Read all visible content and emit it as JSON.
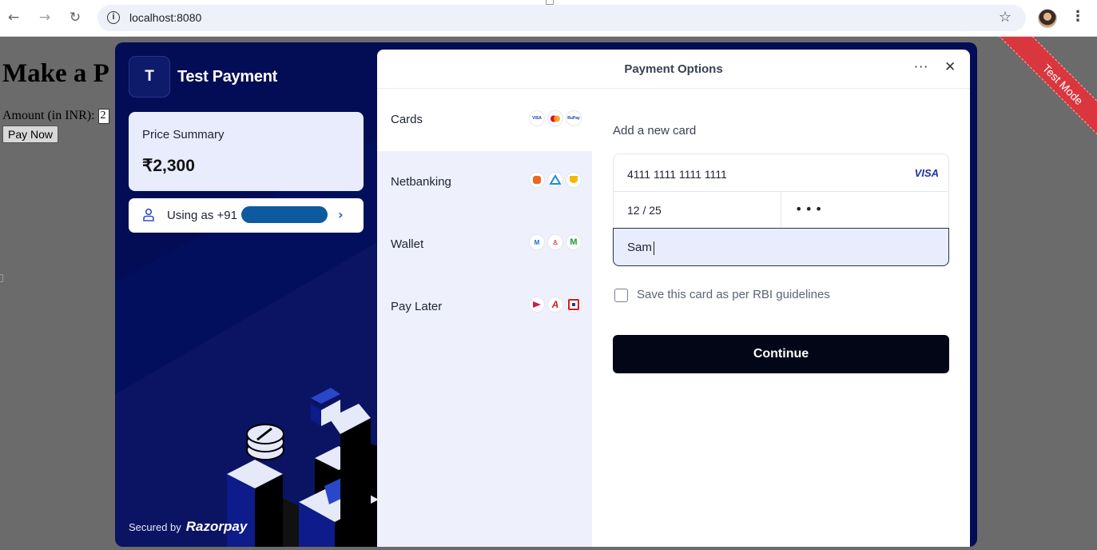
{
  "browser": {
    "url": "localhost:8080"
  },
  "page": {
    "heading": "Make a P",
    "amount_label": "Amount (in INR):",
    "amount_value": "2",
    "pay_button": "Pay Now"
  },
  "ribbon": {
    "label": "Test Mode",
    "color": "#d9363e"
  },
  "merchant": {
    "logo_letter": "T",
    "name": "Test Payment"
  },
  "price_summary": {
    "label": "Price Summary",
    "value": "₹2,300"
  },
  "user": {
    "label": "Using as +91"
  },
  "footer": {
    "secured_by": "Secured by",
    "brand": "Razorpay"
  },
  "panel": {
    "title": "Payment Options"
  },
  "methods": [
    {
      "label": "Cards",
      "icons": [
        "VISA",
        "Mastercard",
        "RuPay"
      ]
    },
    {
      "label": "Netbanking",
      "icons": [
        "bank-1",
        "bank-2",
        "bank-3"
      ]
    },
    {
      "label": "Wallet",
      "icons": [
        "wallet-1",
        "wallet-2",
        "wallet-3"
      ]
    },
    {
      "label": "Pay Later",
      "icons": [
        "paylater-1",
        "paylater-2",
        "paylater-3"
      ]
    }
  ],
  "card_form": {
    "title": "Add a new card",
    "card_number": "4111 1111 1111 1111",
    "network": "VISA",
    "expiry": "12 / 25",
    "cvv": "•••",
    "name": "Sam",
    "save_label": "Save this card as per RBI guidelines",
    "continue_label": "Continue"
  },
  "colors": {
    "modal_bg": "#020d55",
    "continue_bg": "#020616",
    "methods_bg": "#eef1fc"
  }
}
